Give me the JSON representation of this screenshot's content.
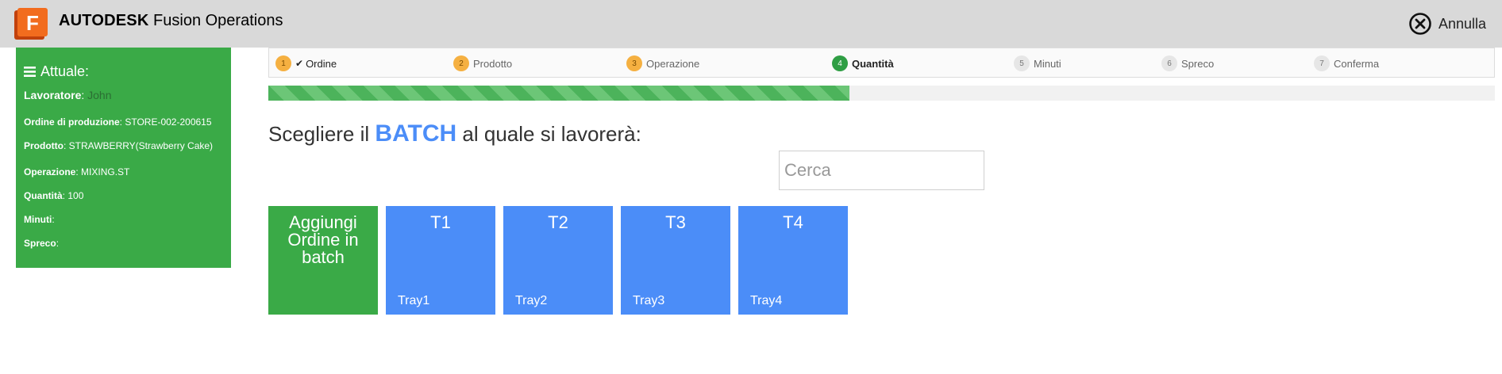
{
  "header": {
    "brand_bold": "AUTODESK",
    "brand_rest": "Fusion Operations",
    "cancel_label": "Annulla"
  },
  "sidebar": {
    "title": "Attuale:",
    "rows": [
      {
        "key": "Lavoratore",
        "value": "John"
      },
      {
        "key": "Ordine di produzione",
        "value": "STORE-002-200615"
      },
      {
        "key": "Prodotto",
        "value": "STRAWBERRY(Strawberry Cake)"
      },
      {
        "key": "Operazione",
        "value": "MIXING.ST"
      },
      {
        "key": "Quantità",
        "value": "100"
      },
      {
        "key": "Minuti",
        "value": ""
      },
      {
        "key": "Spreco",
        "value": ""
      }
    ]
  },
  "steps": [
    {
      "num": "1",
      "label": "Ordine",
      "state": "done"
    },
    {
      "num": "2",
      "label": "Prodotto",
      "state": "next"
    },
    {
      "num": "3",
      "label": "Operazione",
      "state": "next"
    },
    {
      "num": "4",
      "label": "Quantità",
      "state": "active"
    },
    {
      "num": "5",
      "label": "Minuti",
      "state": "todo"
    },
    {
      "num": "6",
      "label": "Spreco",
      "state": "todo"
    },
    {
      "num": "7",
      "label": "Conferma",
      "state": "todo"
    }
  ],
  "progress": {
    "fraction": 0.474
  },
  "heading": {
    "pre": "Scegliere il",
    "highlight": "BATCH",
    "post": "al quale si lavorerà:"
  },
  "search": {
    "placeholder": "Cerca",
    "value": ""
  },
  "add_tile": {
    "label": "Aggiungi Ordine in batch"
  },
  "batches": [
    {
      "code": "T1",
      "name": "Tray1"
    },
    {
      "code": "T2",
      "name": "Tray2"
    },
    {
      "code": "T3",
      "name": "Tray3"
    },
    {
      "code": "T4",
      "name": "Tray4"
    }
  ],
  "colors": {
    "green": "#3aaa47",
    "blue": "#4b8df8",
    "orange": "#f5b041",
    "header_bg": "#d9d9d9"
  }
}
